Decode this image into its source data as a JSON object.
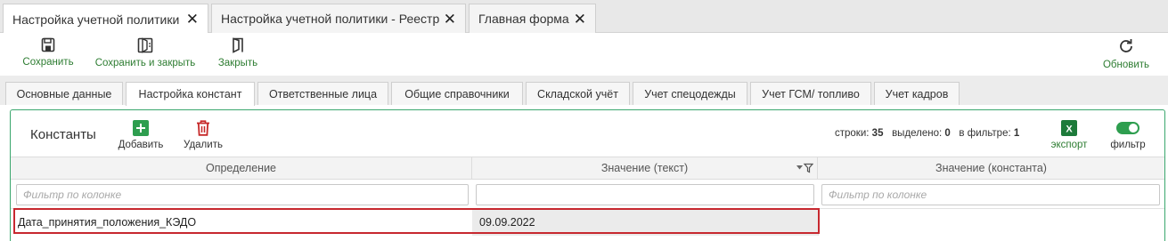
{
  "doc_tabs": [
    {
      "label": "Настройка учетной политики"
    },
    {
      "label": "Настройка учетной политики - Реестр"
    },
    {
      "label": "Главная форма"
    }
  ],
  "toolbar": {
    "save_label": "Сохранить",
    "save_close_label": "Сохранить и закрыть",
    "close_label": "Закрыть",
    "refresh_label": "Обновить"
  },
  "section_tabs": [
    {
      "label": "Основные данные"
    },
    {
      "label": "Настройка констант"
    },
    {
      "label": "Ответственные лица"
    },
    {
      "label": "Общие справочники"
    },
    {
      "label": "Складской учёт"
    },
    {
      "label": "Учет спецодежды"
    },
    {
      "label": "Учет ГСМ/ топливо"
    },
    {
      "label": "Учет кадров"
    }
  ],
  "panel": {
    "title": "Константы",
    "add_label": "Добавить",
    "delete_label": "Удалить",
    "export_label": "экспорт",
    "filter_toggle_label": "фильтр",
    "stats": {
      "rows_label": "строки:",
      "rows_value": "35",
      "selected_label": "выделено:",
      "selected_value": "0",
      "filtered_label": "в фильтре:",
      "filtered_value": "1"
    }
  },
  "grid": {
    "columns": [
      {
        "label": "Определение"
      },
      {
        "label": "Значение (текст)"
      },
      {
        "label": "Значение (константа)"
      }
    ],
    "filter_placeholder": "Фильтр по колонке",
    "rows": [
      {
        "definition": "Дата_принятия_положения_КЭДО",
        "value_text": "09.09.2022",
        "value_const": ""
      }
    ]
  },
  "colors": {
    "accent_green": "#2e7d32",
    "panel_border": "#3aa76d",
    "selection_border": "#c7282f",
    "delete_red": "#c62828"
  }
}
